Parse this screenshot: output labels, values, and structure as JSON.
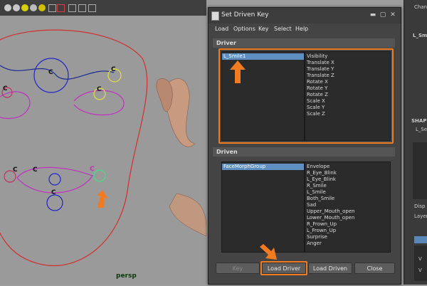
{
  "viewport": {
    "label": "persp"
  },
  "dialog": {
    "title": "Set Driven Key",
    "menus": [
      "Load",
      "Options",
      "Key",
      "Select",
      "Help"
    ],
    "driver": {
      "header": "Driver",
      "objects": [
        "L_Smile1"
      ],
      "attributes": [
        "Visibility",
        "Translate X",
        "Translate Y",
        "Translate Z",
        "Rotate X",
        "Rotate Y",
        "Rotate Z",
        "Scale X",
        "Scale Y",
        "Scale Z"
      ]
    },
    "driven": {
      "header": "Driven",
      "objects": [
        "FaceMorphGroup"
      ],
      "attributes": [
        "Envelope",
        "R_Eye_Blink",
        "L_Eye_Blink",
        "R_Smile",
        "L_Smile",
        "Both_Smile",
        "Sad",
        "Upper_Mouth_open",
        "Lower_Mouth_open",
        "R_Frown_Up",
        "L_Frown_Up",
        "Surprise",
        "Anger"
      ]
    },
    "buttons": {
      "key": "Key",
      "load_driver": "Load Driver",
      "load_driven": "Load Driven",
      "close": "Close"
    }
  },
  "right_panel": {
    "channel": "Chann",
    "lsm": "L_Sm",
    "shape": "SHAP",
    "lse": "L_Se",
    "disp": "Disp",
    "layer": "Layer",
    "v1": "V",
    "v2": "V"
  },
  "colors": {
    "accent": "#f07b20",
    "selection": "#5e8fc0"
  }
}
